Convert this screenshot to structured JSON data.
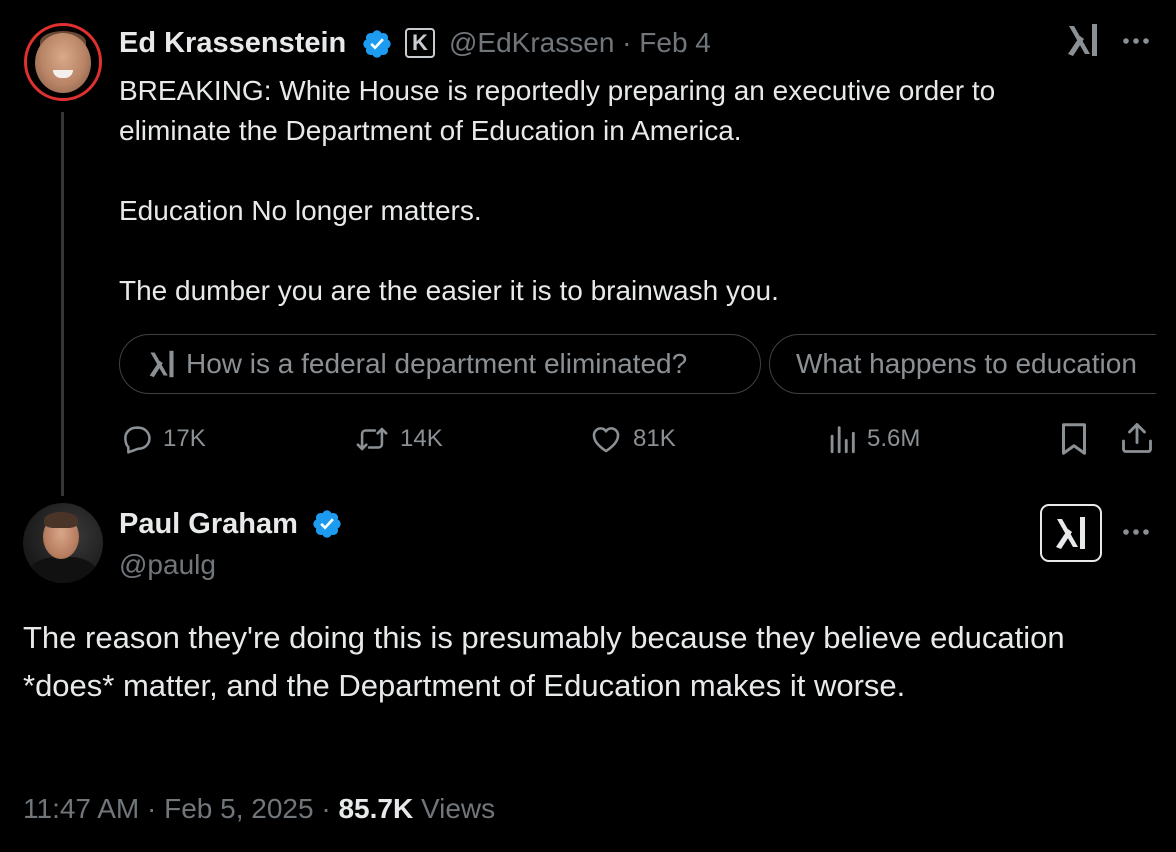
{
  "parent_tweet": {
    "author_name": "Ed Krassenstein",
    "affiliate_badge_letter": "K",
    "handle": "@EdKrassen",
    "separator": "·",
    "date": "Feb 4",
    "text": "BREAKING: White House is reportedly preparing an executive order to\neliminate the Department of Education in America.\n\nEducation No longer matters.\n\nThe dumber you are the easier it is to brainwash you.",
    "grok_suggestions": [
      "How is a federal department eliminated?",
      "What happens to education"
    ],
    "actions": {
      "replies": "17K",
      "reposts": "14K",
      "likes": "81K",
      "views": "5.6M"
    }
  },
  "reply_tweet": {
    "author_name": "Paul Graham",
    "handle": "@paulg",
    "text": "The reason they're doing this is presumably because they believe education *does* matter, and the Department of Education makes it worse.",
    "time": "11:47 AM",
    "date": "Feb 5, 2025",
    "separator": "·",
    "views_count": "85.7K",
    "views_label": "Views"
  },
  "colors": {
    "background": "#000000",
    "text_primary": "#e7e9ea",
    "text_secondary": "#71767b",
    "verified_blue": "#1d9bf0",
    "avatar_ring": "#e0312f",
    "border": "#3e4144"
  },
  "icons": [
    "verified-badge-icon",
    "affiliate-badge-icon",
    "grok-icon",
    "more-icon",
    "reply-icon",
    "repost-icon",
    "like-icon",
    "views-icon",
    "bookmark-icon",
    "share-icon"
  ]
}
